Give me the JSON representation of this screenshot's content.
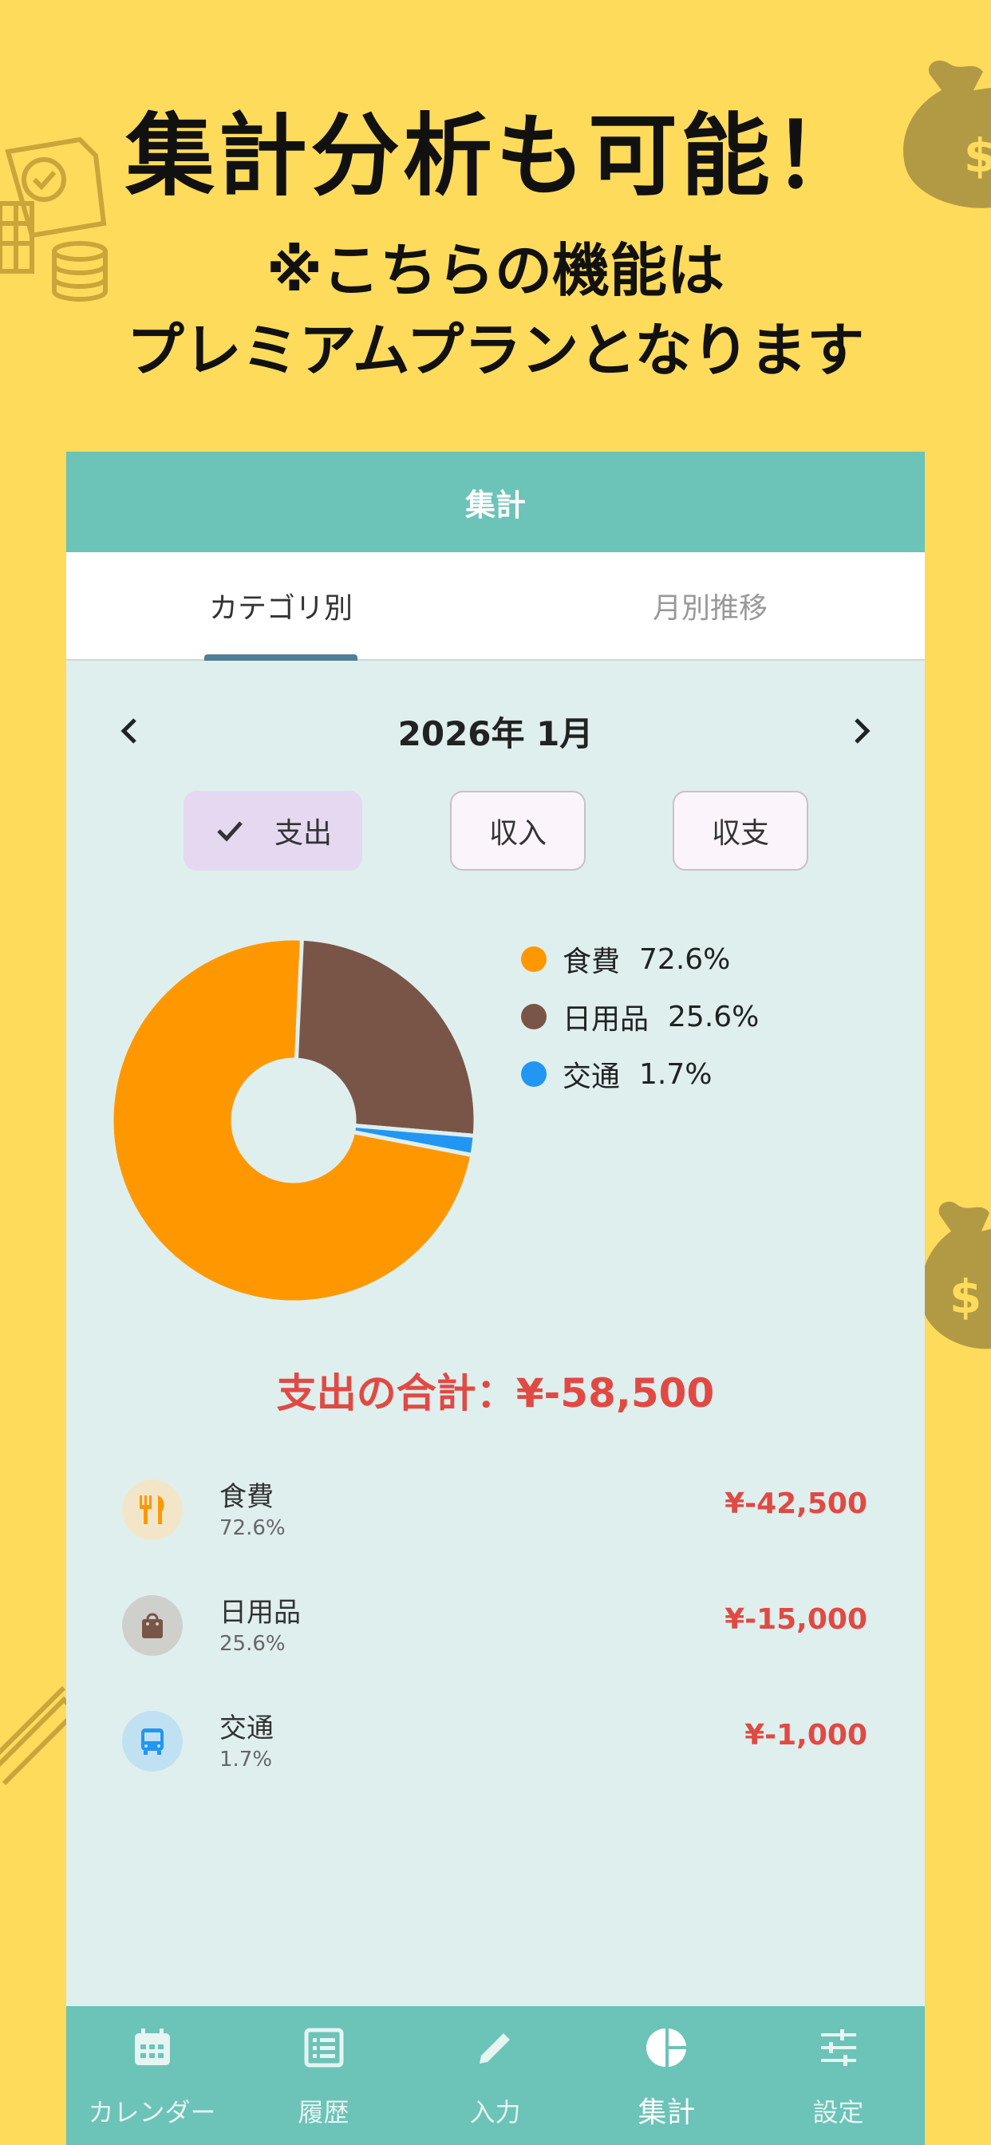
{
  "promo": {
    "headline": "集計分析も可能！",
    "subline1": "※こちらの機能は",
    "subline2": "プレミアムプランとなります"
  },
  "appbar": {
    "title": "集計"
  },
  "tabs": [
    {
      "label": "カテゴリ別",
      "active": true
    },
    {
      "label": "月別推移",
      "active": false
    }
  ],
  "month": {
    "label": "2026年 1月"
  },
  "type_filter": {
    "expense": "支出",
    "income": "収入",
    "balance": "収支",
    "selected": "expense"
  },
  "chart_data": {
    "type": "pie",
    "categories": [
      "食費",
      "日用品",
      "交通"
    ],
    "values": [
      72.6,
      25.6,
      1.7
    ],
    "colors": [
      "#FF9800",
      "#795548",
      "#2196F3"
    ],
    "legend_position": "right"
  },
  "legend": [
    {
      "name": "食費",
      "pct": "72.6%",
      "color": "#FF9800"
    },
    {
      "name": "日用品",
      "pct": "25.6%",
      "color": "#795548"
    },
    {
      "name": "交通",
      "pct": "1.7%",
      "color": "#2196F3"
    }
  ],
  "total": {
    "label": "支出の合計：¥-58,500"
  },
  "categories": [
    {
      "name": "食費",
      "pct": "72.6%",
      "amount": "¥-42,500",
      "icon": "fork-knife-icon",
      "icon_color": "#FF9800",
      "icon_bg": "#F3E6C8"
    },
    {
      "name": "日用品",
      "pct": "25.6%",
      "amount": "¥-15,000",
      "icon": "shopping-bag-icon",
      "icon_color": "#795548",
      "icon_bg": "#CFD0CC"
    },
    {
      "name": "交通",
      "pct": "1.7%",
      "amount": "¥-1,000",
      "icon": "bus-icon",
      "icon_color": "#2196F3",
      "icon_bg": "#BFE1F2"
    }
  ],
  "bottom_nav": [
    {
      "label": "カレンダー",
      "icon": "calendar-icon"
    },
    {
      "label": "履歴",
      "icon": "list-icon"
    },
    {
      "label": "入力",
      "icon": "pencil-icon"
    },
    {
      "label": "集計",
      "icon": "pie-chart-icon",
      "active": true
    },
    {
      "label": "設定",
      "icon": "sliders-icon"
    }
  ],
  "colors": {
    "background": "#FFDB5C",
    "accent": "#6CC3B8",
    "expense_red": "#E04A43"
  }
}
